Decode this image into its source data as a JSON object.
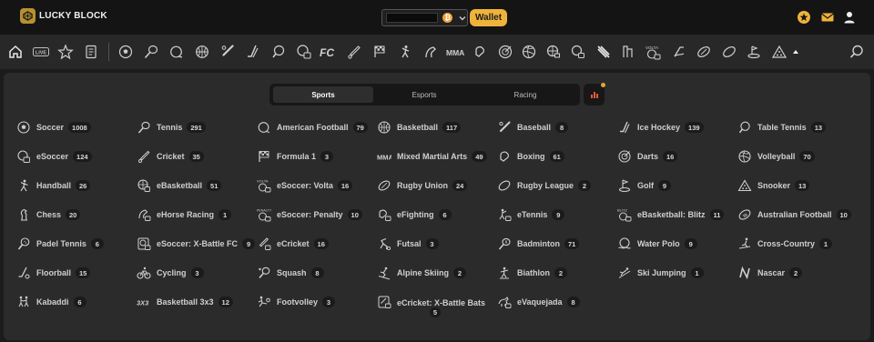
{
  "header": {
    "brand": "LUCKY BLOCK",
    "balance_value": "",
    "coin_symbol": "₿",
    "wallet_label": "Wallet",
    "icons": [
      "star-badge-icon",
      "mail-icon",
      "user-icon"
    ],
    "accent": "#efb23a"
  },
  "category_bar": {
    "icons": [
      "home-icon",
      "live-icon",
      "star-icon",
      "betslip-icon",
      "soccer-icon",
      "tennis-icon",
      "american-football-icon",
      "basketball-icon",
      "baseball-icon",
      "ice-hockey-icon",
      "table-tennis-icon",
      "esoccer-icon",
      "fc-icon",
      "cricket-icon",
      "formula1-icon",
      "handball-icon",
      "ehorse-icon",
      "mma-icon",
      "boxing-icon",
      "darts-icon",
      "volleyball-icon",
      "ebasketball-icon",
      "nascar-icon",
      "rugby-league-icon",
      "efighting-icon",
      "volta-icon",
      "golf-icon",
      "rugby-union-icon",
      "rugby-ball-icon",
      "waterpolo-icon",
      "snooker-icon",
      "more-icon",
      "search-icon"
    ]
  },
  "tabs": [
    {
      "label": "Sports",
      "active": true
    },
    {
      "label": "Esports",
      "active": false
    },
    {
      "label": "Racing",
      "active": false
    }
  ],
  "sports": [
    {
      "name": "Soccer",
      "count": "1008",
      "icon": "soccer-icon"
    },
    {
      "name": "Tennis",
      "count": "291",
      "icon": "tennis-icon"
    },
    {
      "name": "American Football",
      "count": "79",
      "icon": "american-football-icon"
    },
    {
      "name": "Basketball",
      "count": "117",
      "icon": "basketball-icon"
    },
    {
      "name": "Baseball",
      "count": "8",
      "icon": "baseball-icon"
    },
    {
      "name": "Ice Hockey",
      "count": "139",
      "icon": "ice-hockey-icon"
    },
    {
      "name": "Table Tennis",
      "count": "13",
      "icon": "table-tennis-icon"
    },
    {
      "name": "eSoccer",
      "count": "124",
      "icon": "esoccer-icon"
    },
    {
      "name": "Cricket",
      "count": "35",
      "icon": "cricket-icon"
    },
    {
      "name": "Formula 1",
      "count": "3",
      "icon": "formula1-icon"
    },
    {
      "name": "Mixed Martial Arts",
      "count": "49",
      "icon": "mma-icon"
    },
    {
      "name": "Boxing",
      "count": "61",
      "icon": "boxing-icon"
    },
    {
      "name": "Darts",
      "count": "16",
      "icon": "darts-icon"
    },
    {
      "name": "Volleyball",
      "count": "70",
      "icon": "volleyball-icon"
    },
    {
      "name": "Handball",
      "count": "26",
      "icon": "handball-icon"
    },
    {
      "name": "eBasketball",
      "count": "51",
      "icon": "ebasketball-icon"
    },
    {
      "name": "eSoccer: Volta",
      "count": "16",
      "icon": "esoccer-volta-icon"
    },
    {
      "name": "Rugby Union",
      "count": "24",
      "icon": "rugby-union-icon"
    },
    {
      "name": "Rugby League",
      "count": "2",
      "icon": "rugby-league-icon"
    },
    {
      "name": "Golf",
      "count": "9",
      "icon": "golf-icon"
    },
    {
      "name": "Snooker",
      "count": "13",
      "icon": "snooker-icon"
    },
    {
      "name": "Chess",
      "count": "20",
      "icon": "chess-icon"
    },
    {
      "name": "eHorse Racing",
      "count": "1",
      "icon": "ehorse-racing-icon"
    },
    {
      "name": "eSoccer: Penalty",
      "count": "10",
      "icon": "esoccer-penalty-icon"
    },
    {
      "name": "eFighting",
      "count": "6",
      "icon": "efighting-icon"
    },
    {
      "name": "eTennis",
      "count": "9",
      "icon": "etennis-icon"
    },
    {
      "name": "eBasketball: Blitz",
      "count": "11",
      "icon": "ebasketball-blitz-icon"
    },
    {
      "name": "Australian Football",
      "count": "10",
      "icon": "australian-football-icon"
    },
    {
      "name": "Padel Tennis",
      "count": "6",
      "icon": "padel-tennis-icon"
    },
    {
      "name": "eSoccer: X-Battle FC",
      "count": "9",
      "icon": "esoccer-xbattle-icon"
    },
    {
      "name": "eCricket",
      "count": "16",
      "icon": "ecricket-icon"
    },
    {
      "name": "Futsal",
      "count": "3",
      "icon": "futsal-icon"
    },
    {
      "name": "Badminton",
      "count": "71",
      "icon": "badminton-icon"
    },
    {
      "name": "Water Polo",
      "count": "9",
      "icon": "water-polo-icon"
    },
    {
      "name": "Cross-Country",
      "count": "1",
      "icon": "cross-country-icon"
    },
    {
      "name": "Floorball",
      "count": "15",
      "icon": "floorball-icon"
    },
    {
      "name": "Cycling",
      "count": "3",
      "icon": "cycling-icon"
    },
    {
      "name": "Squash",
      "count": "8",
      "icon": "squash-icon"
    },
    {
      "name": "Alpine Skiing",
      "count": "2",
      "icon": "alpine-skiing-icon"
    },
    {
      "name": "Biathlon",
      "count": "2",
      "icon": "biathlon-icon"
    },
    {
      "name": "Ski Jumping",
      "count": "1",
      "icon": "ski-jumping-icon"
    },
    {
      "name": "Nascar",
      "count": "2",
      "icon": "nascar-icon"
    },
    {
      "name": "Kabaddi",
      "count": "6",
      "icon": "kabaddi-icon"
    },
    {
      "name": "Basketball 3x3",
      "count": "12",
      "icon": "basketball-3x3-icon"
    },
    {
      "name": "Footvolley",
      "count": "3",
      "icon": "footvolley-icon"
    },
    {
      "name": "eCricket: X-Battle Bats",
      "count": "5",
      "icon": "ecricket-xbattle-icon"
    },
    {
      "name": "eVaquejada",
      "count": "8",
      "icon": "evaquejada-icon"
    }
  ]
}
